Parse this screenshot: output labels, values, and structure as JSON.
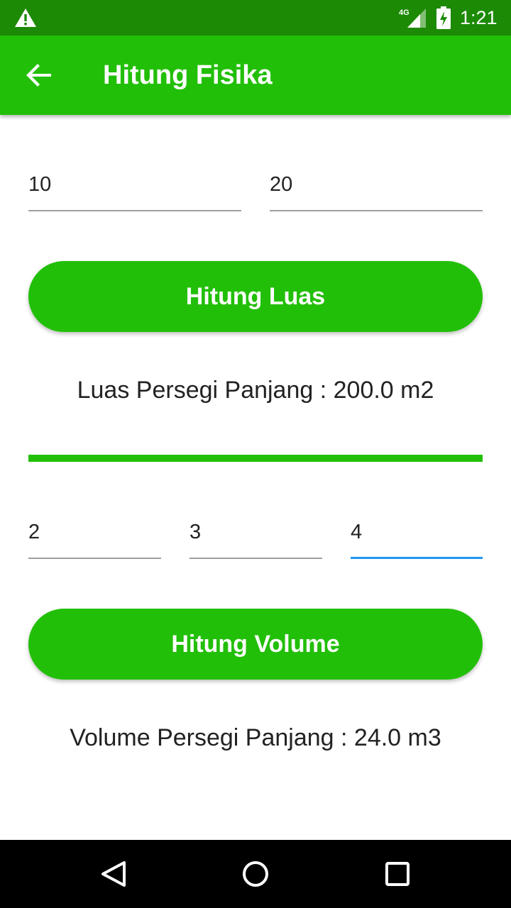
{
  "status_bar": {
    "network": "4G",
    "time": "1:21",
    "icons": [
      "warning-icon",
      "signal-icon",
      "battery-charging-icon"
    ]
  },
  "app_bar": {
    "title": "Hitung Fisika",
    "back_icon": "arrow-back-icon",
    "color": "#22bf08"
  },
  "luas": {
    "panjang_value": "10",
    "lebar_value": "20",
    "button_label": "Hitung Luas",
    "result_text": "Luas Persegi Panjang : 200.0 m2"
  },
  "volume": {
    "panjang_value": "2",
    "lebar_value": "3",
    "tinggi_value": "4",
    "button_label": "Hitung Volume",
    "result_text": "Volume Persegi Panjang : 24.0 m3"
  },
  "nav_bar": {
    "icons": [
      "back-triangle-icon",
      "home-circle-icon",
      "recents-square-icon"
    ]
  },
  "colors": {
    "accent": "#22bf08",
    "status_bar": "#1c8a05",
    "focus": "#2196f3"
  }
}
